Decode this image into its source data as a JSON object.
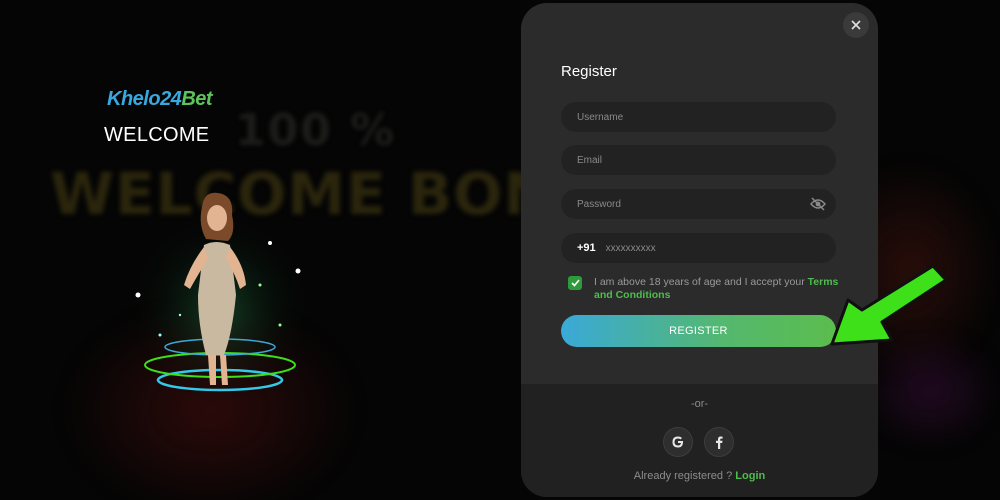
{
  "background": {
    "promo_line1": "100 %",
    "promo_line2": "WELCOME BONUS"
  },
  "brand": {
    "logo_part1": "Khelo",
    "logo_part2": "24",
    "logo_part3": "Bet",
    "welcome": "WELCOME"
  },
  "modal": {
    "title": "Register",
    "close_icon": "close-icon",
    "fields": {
      "username_placeholder": "Username",
      "email_placeholder": "Email",
      "password_placeholder": "Password",
      "phone_prefix": "+91",
      "phone_placeholder": "xxxxxxxxxx"
    },
    "terms": {
      "checked": true,
      "text": "I am above 18 years of age and I accept your",
      "link": "Terms and Conditions"
    },
    "register_label": "REGISTER",
    "or_label": "-or-",
    "social": {
      "google_letter": "G",
      "facebook_letter": "f"
    },
    "already_text": "Already registered ?",
    "login_link": "Login"
  },
  "colors": {
    "accent_green": "#4dbd4d",
    "accent_blue": "#3aa9d8",
    "arrow_green": "#3ee01a"
  }
}
